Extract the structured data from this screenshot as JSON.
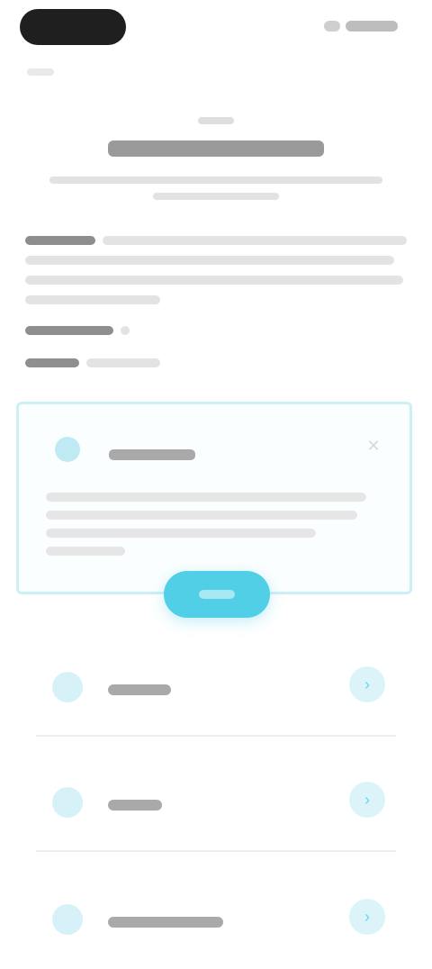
{
  "status_bar": {
    "left_pill": "",
    "right": ""
  },
  "header": {
    "kicker": "",
    "title": "",
    "subtitle": ""
  },
  "description": {
    "lead": "",
    "text": ""
  },
  "meta": [
    {
      "key": "",
      "value": ""
    },
    {
      "key": "",
      "value": ""
    }
  ],
  "info_card": {
    "title": "",
    "body": "",
    "close_icon": "close-icon",
    "accent": "#50cfe7"
  },
  "cta": {
    "label": ""
  },
  "list": [
    {
      "label": "",
      "icon": "circle-icon",
      "chevron": "chevron-right-icon"
    },
    {
      "label": "",
      "icon": "circle-icon",
      "chevron": "chevron-right-icon"
    },
    {
      "label": "",
      "icon": "circle-icon",
      "chevron": "chevron-right-icon"
    }
  ],
  "colors": {
    "accent": "#50cfe7",
    "accent_light": "#d6f1f7",
    "card_border": "#cdeff6",
    "text_dark": "#2b2b2b"
  }
}
